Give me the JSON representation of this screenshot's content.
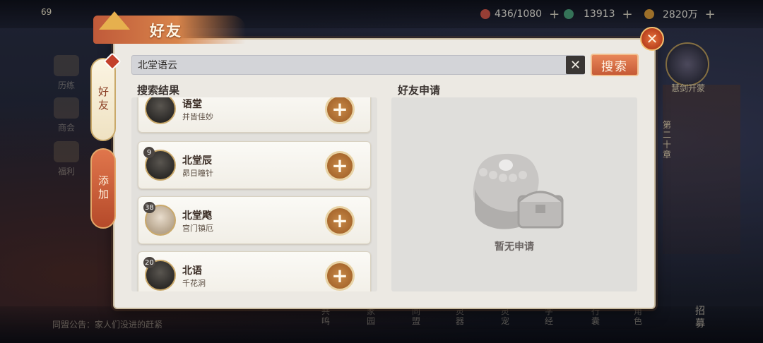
{
  "topbar": {
    "level": "69",
    "resources": [
      {
        "icon": "stamina-icon",
        "value": "436/1080",
        "color": "#d0564a"
      },
      {
        "icon": "jade-icon",
        "value": "13913",
        "color": "#4aa07a"
      },
      {
        "icon": "coin-icon",
        "value": "2820万",
        "color": "#d89a3a"
      }
    ]
  },
  "background": {
    "left_menu": [
      "历练",
      "商会",
      "福利"
    ],
    "right_avatar_label": "慧剑开蒙",
    "chapter_label": "第二十章",
    "notice": "同盟公告：家人们没进的赶紧",
    "bottom_items": [
      "共鸣",
      "家园",
      "同盟",
      "灵器",
      "灵宠",
      "字经",
      "行囊",
      "角色"
    ],
    "recruit": "招募"
  },
  "dialog": {
    "title": "好友",
    "tabs": [
      {
        "label": "好友",
        "active": true
      },
      {
        "label": "添加",
        "active": false
      }
    ],
    "search": {
      "value": "北堂语云",
      "clear_icon": "close-icon",
      "button_label": "搜索"
    },
    "results_label": "搜索结果",
    "requests_label": "好友申请",
    "results": [
      {
        "name": "语堂",
        "sect": "并皆佳妙",
        "level": ""
      },
      {
        "name": "北堂辰",
        "sect": "昴日瞳针",
        "level": "9"
      },
      {
        "name": "北堂飑",
        "sect": "宫门镇厄",
        "level": "38"
      },
      {
        "name": "北语",
        "sect": "千花洞",
        "level": "20"
      }
    ],
    "requests_empty_text": "暂无申请"
  },
  "colors": {
    "accent": "#c65a36",
    "panel_bg": "#ece9e3",
    "add_button": "#b8763a"
  }
}
